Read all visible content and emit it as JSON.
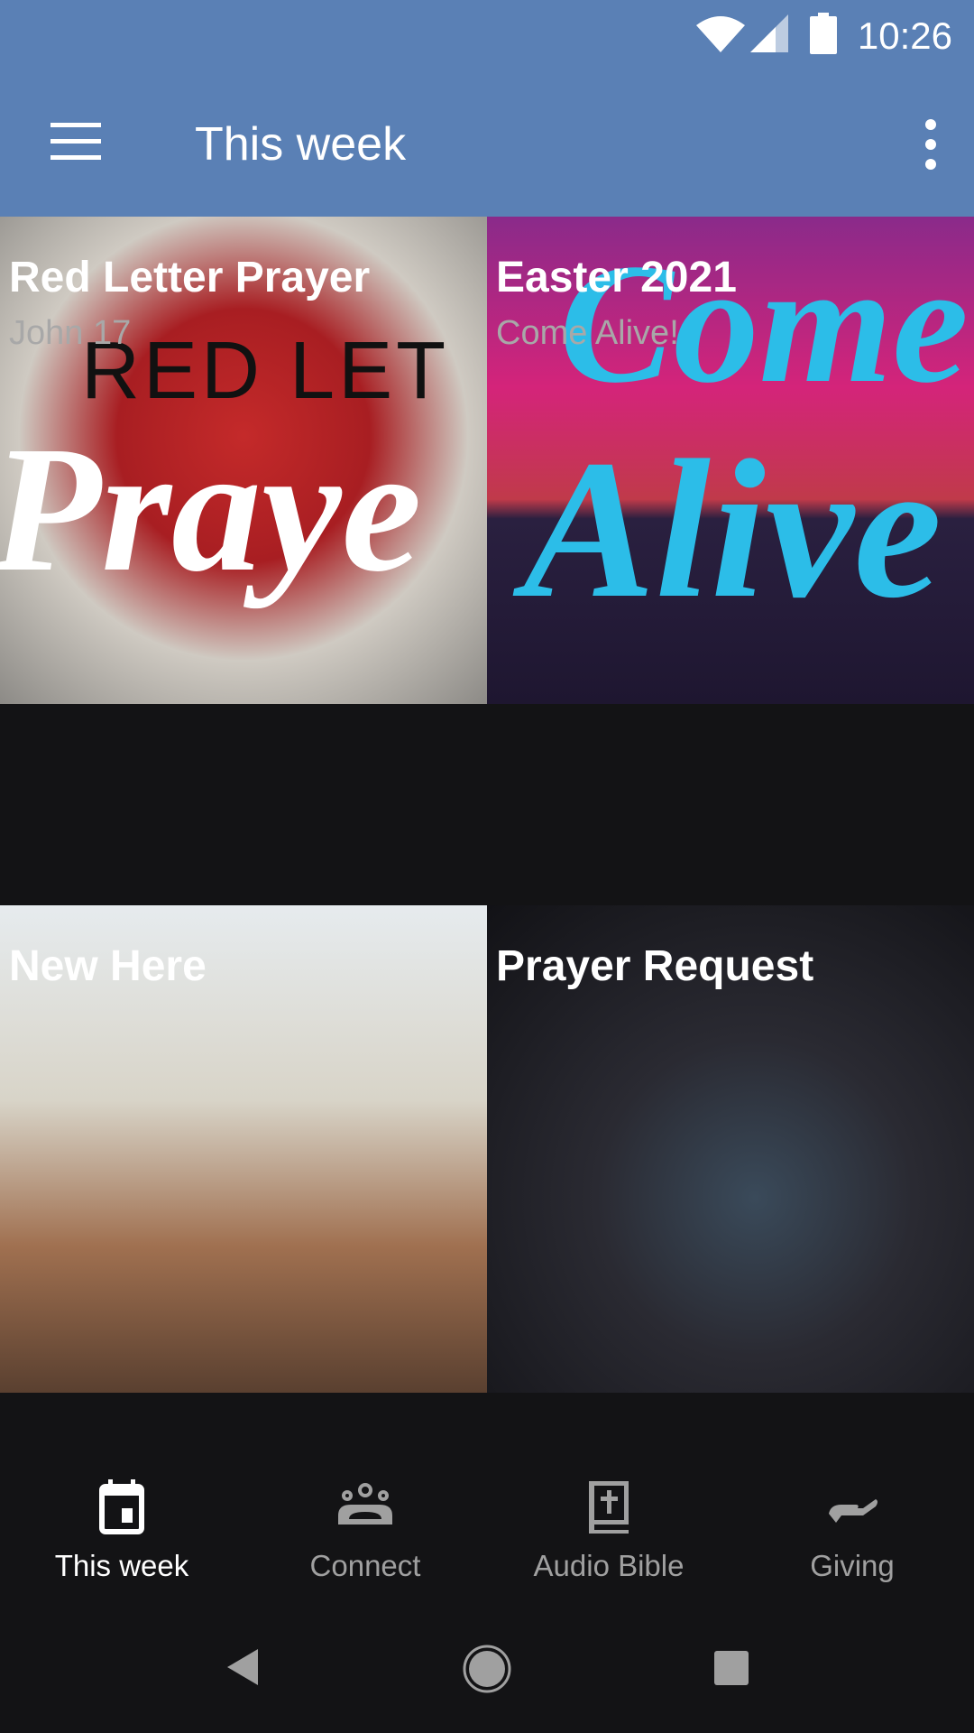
{
  "status_bar": {
    "time": "10:26",
    "icons": [
      "wifi-icon",
      "signal-icon",
      "battery-icon"
    ]
  },
  "app_bar": {
    "title": "This week",
    "menu_icon": "hamburger-menu-icon",
    "more_icon": "more-vert-icon"
  },
  "colors": {
    "app_bar": "#5a80b5",
    "background": "#131315",
    "inactive": "#a0a0a0"
  },
  "cards": [
    {
      "title": "Red Letter Prayer",
      "subtitle": "John 17",
      "image_text": "RED LETTER Prayer"
    },
    {
      "title": "Easter 2021",
      "subtitle": "Come Alive!",
      "image_text": "Come Alive"
    },
    {
      "title": "New Here",
      "subtitle": ""
    },
    {
      "title": "Prayer Request",
      "subtitle": ""
    }
  ],
  "bottom_nav": [
    {
      "label": "This week",
      "icon": "calendar-icon",
      "active": true
    },
    {
      "label": "Connect",
      "icon": "groups-icon",
      "active": false
    },
    {
      "label": "Audio Bible",
      "icon": "bible-icon",
      "active": false
    },
    {
      "label": "Giving",
      "icon": "giving-hand-icon",
      "active": false
    }
  ],
  "system_nav": [
    "back-icon",
    "home-icon",
    "recents-icon"
  ]
}
